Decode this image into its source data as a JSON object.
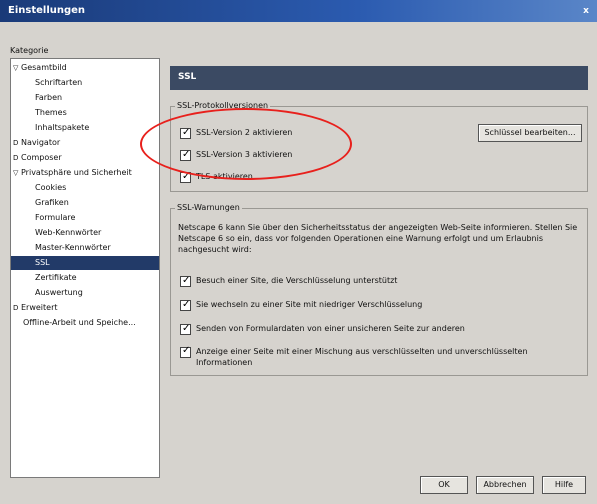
{
  "window": {
    "title": "Einstellungen",
    "close_label": "x"
  },
  "sidebar": {
    "label": "Kategorie",
    "items": [
      {
        "label": "Gesamtbild",
        "expander": "▽",
        "level": 0
      },
      {
        "label": "Schriftarten",
        "level": 1
      },
      {
        "label": "Farben",
        "level": 1
      },
      {
        "label": "Themes",
        "level": 1
      },
      {
        "label": "Inhaltspakete",
        "level": 1
      },
      {
        "label": "Navigator",
        "expander": "D",
        "level": 0
      },
      {
        "label": "Composer",
        "expander": "D",
        "level": 0
      },
      {
        "label": "Privatsphäre und Sicherheit",
        "expander": "▽",
        "level": 0
      },
      {
        "label": "Cookies",
        "level": 1
      },
      {
        "label": "Grafiken",
        "level": 1
      },
      {
        "label": "Formulare",
        "level": 1
      },
      {
        "label": "Web-Kennwörter",
        "level": 1
      },
      {
        "label": "Master-Kennwörter",
        "level": 1
      },
      {
        "label": "SSL",
        "level": 1,
        "selected": true
      },
      {
        "label": "Zertifikate",
        "level": 1
      },
      {
        "label": "Auswertung",
        "level": 1
      },
      {
        "label": "Erweitert",
        "expander": "D",
        "level": 0
      },
      {
        "label": "Offline-Arbeit und Speiche...",
        "level": 1
      }
    ]
  },
  "main": {
    "header": "SSL",
    "protocol_group": {
      "legend": "SSL-Protokollversionen",
      "checkboxes": [
        {
          "label": "SSL-Version 2 aktivieren",
          "checked": true
        },
        {
          "label": "SSL-Version 3 aktivieren",
          "checked": true
        },
        {
          "label": "TLS aktivieren",
          "checked": true
        }
      ],
      "edit_keys_button": "Schlüssel bearbeiten..."
    },
    "warnings_group": {
      "legend": "SSL-Warnungen",
      "description": "Netscape 6 kann Sie über den Sicherheitsstatus der angezeigten Web-Seite informieren. Stellen Sie Netscape 6 so ein, dass vor folgenden Operationen eine Warnung erfolgt und um Erlaubnis nachgesucht wird:",
      "checkboxes": [
        {
          "label": "Besuch einer Site, die Verschlüsselung unterstützt",
          "checked": true
        },
        {
          "label": "Sie wechseln zu einer Site mit niedriger Verschlüsselung",
          "checked": true
        },
        {
          "label": "Senden von Formulardaten von einer unsicheren Seite zur anderen",
          "checked": true
        },
        {
          "label": "Anzeige einer Seite mit einer Mischung aus verschlüsselten und unverschlüsselten Informationen",
          "checked": true
        }
      ]
    }
  },
  "footer": {
    "ok": "OK",
    "cancel": "Abbrechen",
    "help": "Hilfe"
  },
  "colors": {
    "selection": "#223a68",
    "header_bar": "#3b4a63",
    "annotation_circle": "#e8201c"
  }
}
